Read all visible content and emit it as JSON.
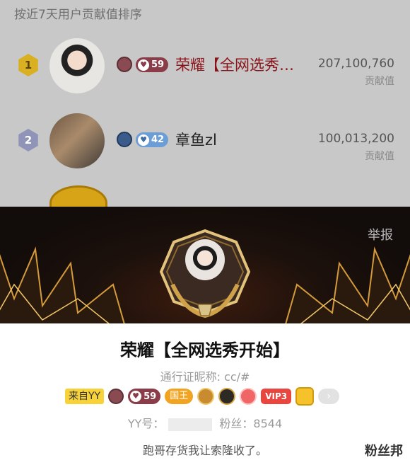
{
  "list": {
    "header": "按近7天用户贡献值排序",
    "rows": [
      {
        "rank": "1",
        "level": "59",
        "name": "荣耀【全网选秀…",
        "score": "207,100,760",
        "score_label": "贡献值"
      },
      {
        "rank": "2",
        "level": "42",
        "name": "章鱼zl",
        "score": "100,013,200",
        "score_label": "贡献值"
      }
    ]
  },
  "profile": {
    "report": "举报",
    "name": "荣耀【全网选秀开始】",
    "pass_name": "通行证昵称: cc/#",
    "badges": {
      "from": "来自YY",
      "level": "59",
      "king": "国王",
      "vip": "VIP3"
    },
    "yy_label": "YY号：",
    "fans": "粉丝：8544",
    "signature": "跑哥存货我让索隆收了。",
    "watermark": "粉丝邦"
  },
  "colors": {
    "name_red": "#8a1218",
    "gold": "#d9b022",
    "pill_red": "#8a3c48",
    "pill_blue": "#6b9ed6"
  },
  "icons": [
    "rank-gold-icon",
    "rank-silver-icon",
    "level-icon",
    "heart-icon",
    "wing-icon",
    "laurel-frame-icon",
    "crown-icon",
    "medal-icon",
    "seal-icon",
    "treasure-icon",
    "chevron-right-icon"
  ]
}
